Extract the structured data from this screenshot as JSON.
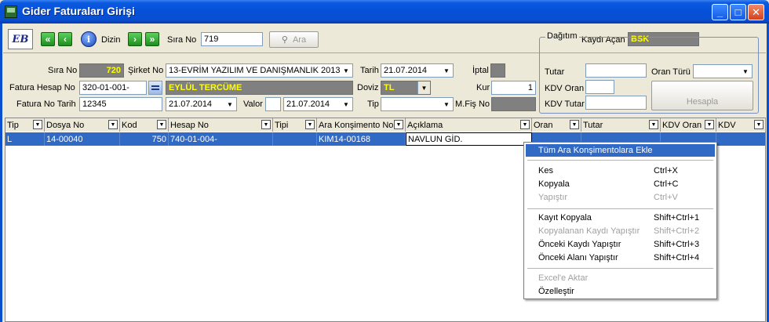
{
  "window": {
    "title": "Gider Faturaları Girişi"
  },
  "toolbar": {
    "logo_text": "EB",
    "first": "«",
    "prev": "‹",
    "next": "›",
    "last": "»",
    "info_glyph": "i",
    "dizin_label": "Dizin",
    "sira_no_label": "Sıra No",
    "sira_no_value": "719",
    "ara_label": "Ara",
    "kaydi_acan_label": "Kaydı Açan",
    "kaydi_acan_value": "BSK"
  },
  "form": {
    "sira_no_label": "Sıra No",
    "sira_no_value": "720",
    "sirket_no_label": "Şirket No",
    "sirket_no_value": "13-EVRİM YAZILIM VE DANIŞMANLIK 2013",
    "tarih_label": "Tarih",
    "tarih_value": "21.07.2014",
    "iptal_label": "İptal",
    "fatura_hesap_no_label": "Fatura Hesap No",
    "fatura_hesap_no_value": "320-01-001-",
    "cari_name": "EYLÜL TERCÜME",
    "doviz_label": "Doviz",
    "doviz_value": "TL",
    "kur_label": "Kur",
    "kur_value": "1",
    "fatura_no_tarih_label": "Fatura No Tarih",
    "fatura_no_value": "12345",
    "fatura_tarih_value": "21.07.2014",
    "valor_label": "Valor",
    "valor_tarih_value": "21.07.2014",
    "tip_label": "Tip",
    "mfis_no_label": "M.Fiş No"
  },
  "dagitim": {
    "legend": "Dağıtım",
    "tutar_label": "Tutar",
    "oran_turu_label": "Oran Türü",
    "kdv_oran_label": "KDV Oran",
    "kdv_tutar_label": "KDV Tutar",
    "hesapla_label": "Hesapla"
  },
  "grid": {
    "columns": [
      "Tip",
      "Dosya No",
      "Kod",
      "Hesap No",
      "Tipi",
      "Ara Konşimento No",
      "Açıklama",
      "Oran",
      "Tutar",
      "KDV Oran",
      "KDV",
      ""
    ],
    "row": {
      "tip": "L",
      "dosya_no": "14-00040",
      "kod": "750",
      "hesap_no": "740-01-004-",
      "tipi": "",
      "ara_konsimento_no": "KIM14-00168",
      "aciklama": "NAVLUN GİD."
    }
  },
  "context_menu": {
    "items": [
      {
        "label": "Tüm Ara Konşimentolara Ekle",
        "shortcut": ""
      },
      {
        "label": "Kes",
        "shortcut": "Ctrl+X"
      },
      {
        "label": "Kopyala",
        "shortcut": "Ctrl+C"
      },
      {
        "label": "Yapıştır",
        "shortcut": "Ctrl+V"
      },
      {
        "label": "Kayıt Kopyala",
        "shortcut": "Shift+Ctrl+1"
      },
      {
        "label": "Kopyalanan Kaydı Yapıştır",
        "shortcut": "Shift+Ctrl+2"
      },
      {
        "label": "Önceki Kaydı Yapıştır",
        "shortcut": "Shift+Ctrl+3"
      },
      {
        "label": "Önceki Alanı Yapıştır",
        "shortcut": "Shift+Ctrl+4"
      },
      {
        "label": "Excel'e Aktar",
        "shortcut": ""
      },
      {
        "label": "Özelleştir",
        "shortcut": ""
      }
    ]
  },
  "colors": {
    "title_bar": "#0a4fd0",
    "highlight": "#316ac5",
    "yellow_text": "#ffff00",
    "gray_field": "#808080"
  }
}
